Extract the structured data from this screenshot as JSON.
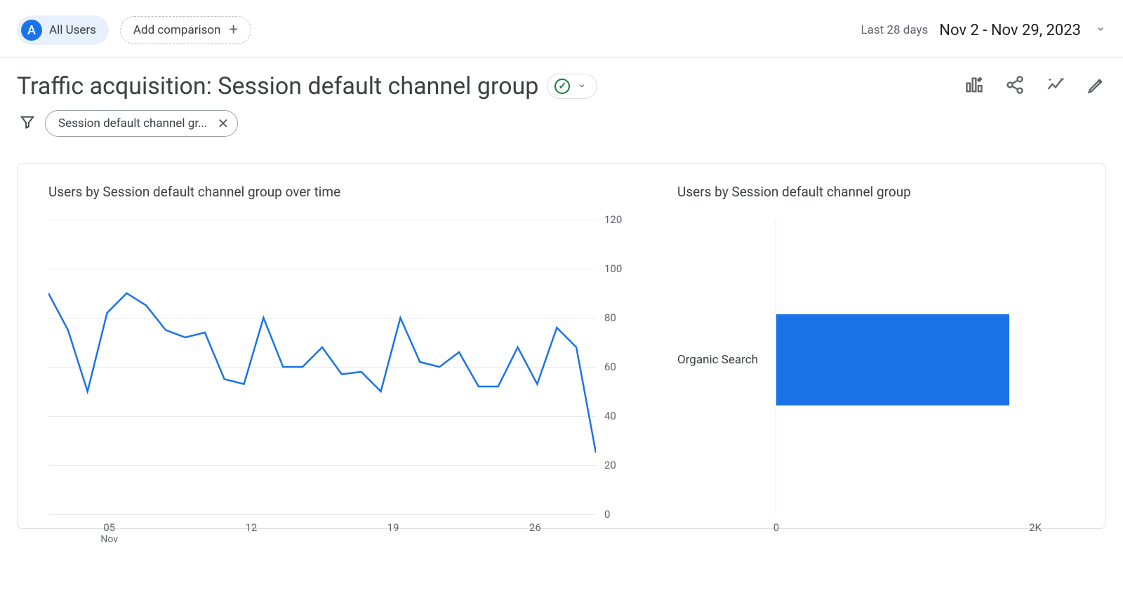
{
  "topbar": {
    "avatar_letter": "A",
    "all_users_label": "All Users",
    "add_comparison_label": "Add comparison",
    "date_prefix": "Last 28 days",
    "date_range": "Nov 2 - Nov 29, 2023"
  },
  "title": {
    "text": "Traffic acquisition: Session default channel group"
  },
  "filter": {
    "chip_label": "Session default channel gr..."
  },
  "chart_left_title": "Users by Session default channel group over time",
  "chart_right_title": "Users by Session default channel group",
  "chart_data": [
    {
      "type": "line",
      "title": "Users by Session default channel group over time",
      "xlabel": "Nov",
      "ylabel": "",
      "ylim": [
        0,
        120
      ],
      "y_ticks": [
        0,
        20,
        40,
        60,
        80,
        100,
        120
      ],
      "x_tick_labels": [
        "05",
        "12",
        "19",
        "26"
      ],
      "x_tick_sublabel": "Nov",
      "x": [
        2,
        3,
        4,
        5,
        6,
        7,
        8,
        9,
        10,
        11,
        12,
        13,
        14,
        15,
        16,
        17,
        18,
        19,
        20,
        21,
        22,
        23,
        24,
        25,
        26,
        27,
        28,
        29
      ],
      "series": [
        {
          "name": "Organic Search",
          "color": "#1a73e8",
          "values": [
            90,
            75,
            50,
            82,
            90,
            85,
            75,
            72,
            74,
            55,
            53,
            80,
            60,
            60,
            68,
            57,
            58,
            50,
            80,
            62,
            60,
            66,
            52,
            52,
            68,
            53,
            76,
            68,
            25
          ]
        }
      ]
    },
    {
      "type": "bar",
      "orientation": "horizontal",
      "title": "Users by Session default channel group",
      "xlim": [
        0,
        2000
      ],
      "x_tick_labels": [
        "0",
        "2K"
      ],
      "categories": [
        "Organic Search"
      ],
      "series": [
        {
          "name": "Users",
          "color": "#1a73e8",
          "values": [
            1800
          ]
        }
      ]
    }
  ]
}
